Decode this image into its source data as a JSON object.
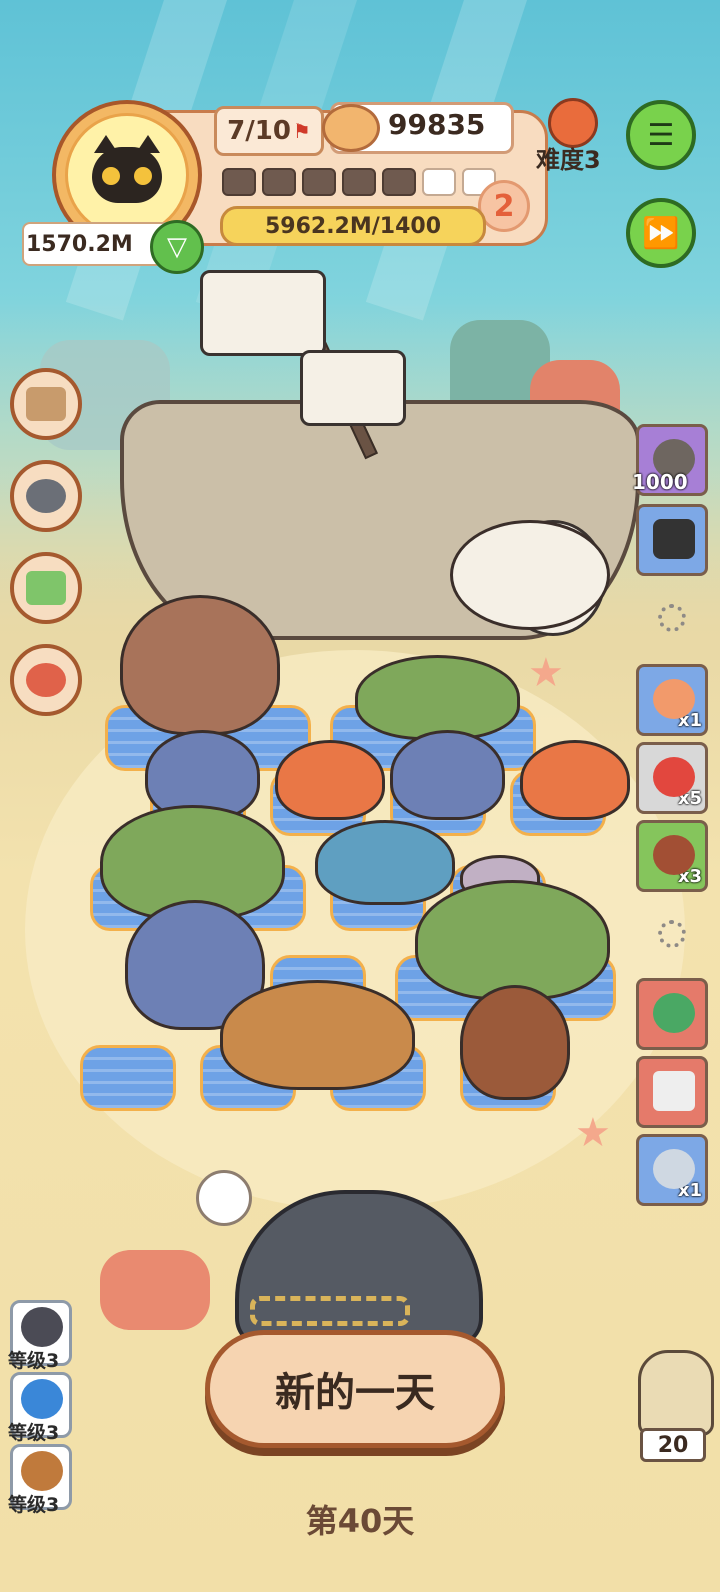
{
  "hud": {
    "population": "7/10",
    "coins": "99835",
    "difficulty": "难度3",
    "cash": "1570.2M",
    "progress_text": "5962.2M/1400",
    "level_badge": "2",
    "segments_total": 7,
    "segments_filled": 5
  },
  "right_items": [
    {
      "name": "shell-nugget-item",
      "qty": "1000",
      "color": "#a77fd6"
    },
    {
      "name": "camera-item",
      "qty": "",
      "color": "#7da8e6"
    },
    {
      "name": "lifebuoy-item",
      "qty": "x1",
      "color": "#7da8e6"
    },
    {
      "name": "fishing-float-item",
      "qty": "x5",
      "color": "#d8d8d8"
    },
    {
      "name": "meat-item",
      "qty": "x3",
      "color": "#85c55c"
    },
    {
      "name": "meteor-item",
      "qty": "",
      "color": "#e57a6a"
    },
    {
      "name": "toolkit-item",
      "qty": "",
      "color": "#e57a6a"
    },
    {
      "name": "flying-fish-item",
      "qty": "x1",
      "color": "#7da8e6"
    }
  ],
  "left_levels": [
    {
      "label": "等级3",
      "color": "#4b4b55"
    },
    {
      "label": "等级3",
      "color": "#3a87d8"
    },
    {
      "label": "等级3",
      "color": "#c07a3c"
    }
  ],
  "new_day_button": "新的一天",
  "day_label": "第40天",
  "owl_count": "20",
  "colors": {
    "accent": "#a5592e",
    "green_button": "#79d24c",
    "tile": "#6ea2e6"
  }
}
